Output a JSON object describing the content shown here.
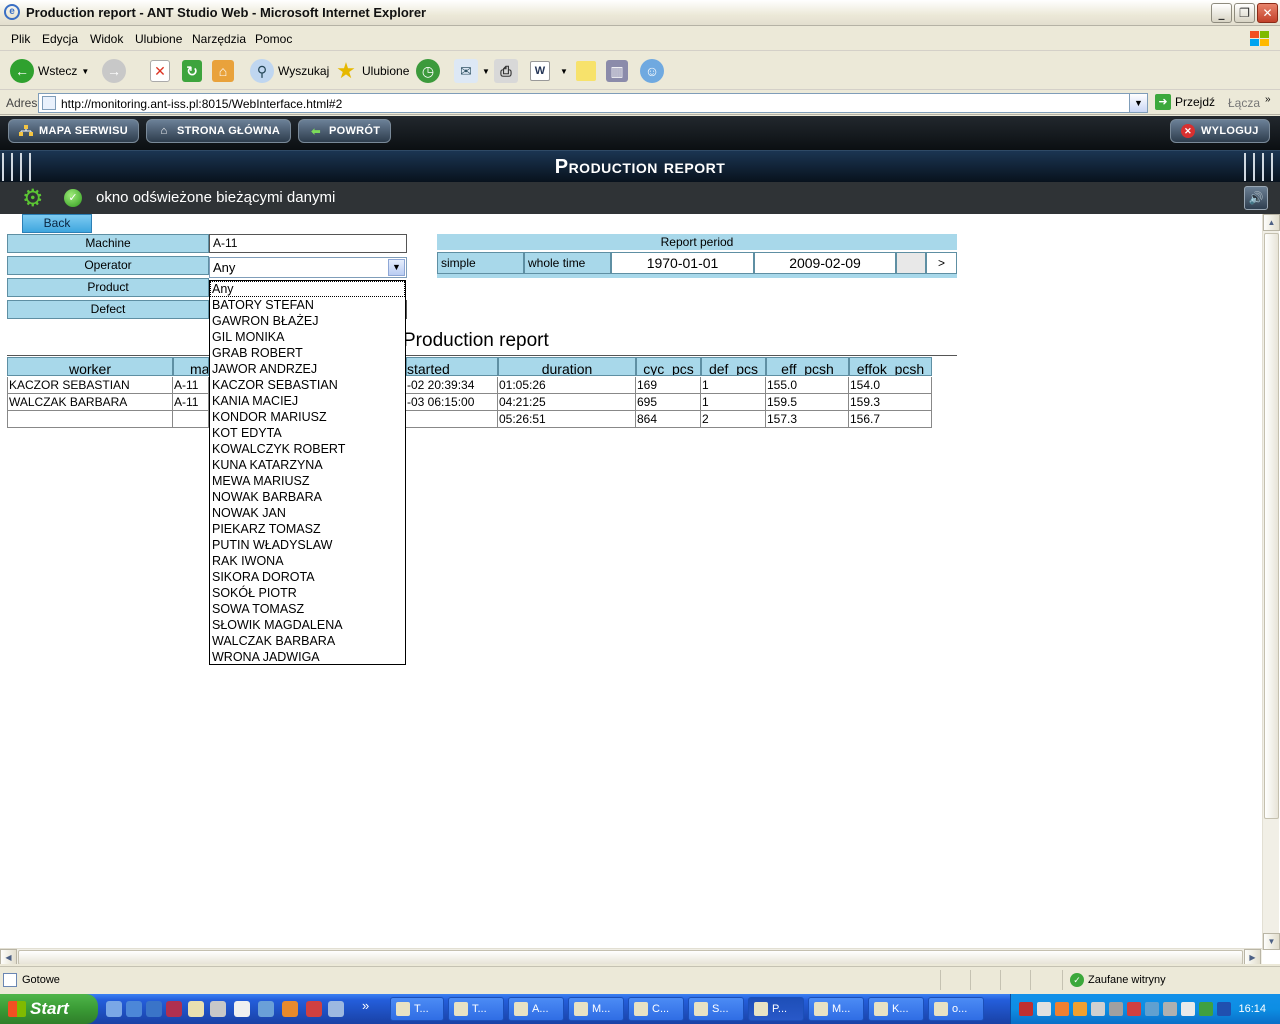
{
  "window": {
    "title": "Production report - ANT Studio Web - Microsoft Internet Explorer",
    "icon": "ie-icon"
  },
  "menu": [
    "Plik",
    "Edycja",
    "Widok",
    "Ulubione",
    "Narzędzia",
    "Pomoc"
  ],
  "toolbar": {
    "back_label": "Wstecz",
    "search_label": "Wyszukaj",
    "favorites_label": "Ulubione"
  },
  "address": {
    "label": "Adres",
    "url": "http://monitoring.ant-iss.pl:8015/WebInterface.html#2",
    "go_label": "Przejdź",
    "links_label": "Łącza"
  },
  "nav": {
    "site_map": "MAPA SERWISU",
    "home": "STRONA GŁÓWNA",
    "back": "POWRÓT",
    "logout": "WYLOGUJ"
  },
  "header": {
    "title": "Production report"
  },
  "status": {
    "message": "okno odświeżone bieżącymi danymi"
  },
  "page": {
    "back_button": "Back",
    "filters": {
      "machine_label": "Machine",
      "machine_value": "A-11",
      "operator_label": "Operator",
      "operator_value": "Any",
      "product_label": "Product",
      "defect_label": "Defect"
    },
    "operator_options": [
      "Any",
      "BATORY STEFAN",
      "GAWRON BŁAŻEJ",
      "GIL MONIKA",
      "GRAB ROBERT",
      "JAWOR ANDRZEJ",
      "KACZOR SEBASTIAN",
      "KANIA MACIEJ",
      "KONDOR MARIUSZ",
      "KOT EDYTA",
      "KOWALCZYK ROBERT",
      "KUNA KATARZYNA",
      "MEWA MARIUSZ",
      "NOWAK BARBARA",
      "NOWAK JAN",
      "PIEKARZ TOMASZ",
      "PUTIN WŁADYSLAW",
      "RAK IWONA",
      "SIKORA DOROTA",
      "SOKÓŁ PIOTR",
      "SOWA TOMASZ",
      "SŁOWIK MAGDALENA",
      "WALCZAK BARBARA",
      "WRONA JADWIGA"
    ],
    "report_period": {
      "title": "Report period",
      "mode": "simple",
      "range": "whole time",
      "from": "1970-01-01",
      "to": "2009-02-09",
      "next": ">"
    },
    "report_title": "Production report",
    "table": {
      "headers": [
        "worker",
        "ma",
        "started",
        "duration",
        "cyc_pcs",
        "def_pcs",
        "eff_pcsh",
        "effok_pcsh"
      ],
      "rows": [
        [
          "KACZOR SEBASTIAN",
          "A-11",
          "-02 20:39:34",
          "01:05:26",
          "169",
          "1",
          "155.0",
          "154.0"
        ],
        [
          "WALCZAK BARBARA",
          "A-11",
          "-03 06:15:00",
          "04:21:25",
          "695",
          "1",
          "159.5",
          "159.3"
        ],
        [
          "",
          "",
          "",
          "05:26:51",
          "864",
          "2",
          "157.3",
          "156.7"
        ]
      ]
    }
  },
  "statusbar": {
    "text": "Gotowe",
    "zone": "Zaufane witryny"
  },
  "taskbar": {
    "start": "Start",
    "tasks": [
      "T...",
      "T...",
      "A...",
      "M...",
      "C...",
      "S...",
      "P...",
      "M...",
      "K...",
      "o..."
    ],
    "clock": "16:14"
  }
}
